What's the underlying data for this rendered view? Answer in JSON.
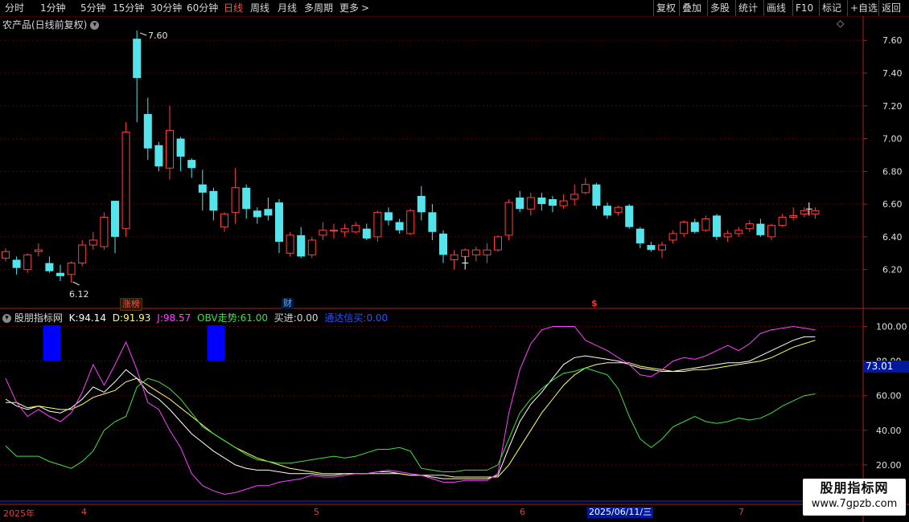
{
  "topbar": {
    "timeframes": [
      "分时",
      "1分钟",
      "5分钟",
      "15分钟",
      "30分钟",
      "60分钟",
      "日线",
      "周线",
      "月线",
      "多周期",
      "更多"
    ],
    "active_timeframe": "日线",
    "more_arrow": ">",
    "right_buttons": [
      "复权",
      "叠加",
      "多股",
      "统计",
      "画线",
      "F10",
      "标记",
      "+自选",
      "返回"
    ]
  },
  "main_pane": {
    "title": "农产品(日线前复权)",
    "dropdown_icon": "circle-chevron-down-icon",
    "diamond_icon": "◇",
    "high_label": "7.60",
    "low_label": "6.12",
    "badges": [
      {
        "text": "涨榜",
        "color": "#ff5050"
      },
      {
        "text": "财",
        "color": "#6fa8ff"
      },
      {
        "text": "$",
        "color": "#ff3030"
      }
    ]
  },
  "indicator_pane": {
    "name": "股朋指标网",
    "k_label": "K:",
    "k_value": "94.14",
    "d_label": "D:",
    "d_value": "91.93",
    "j_label": "J:",
    "j_value": "98.57",
    "obv_label": "OBV走势:",
    "obv_value": "61.00",
    "buy_label": "买进:",
    "buy_value": "0.00",
    "signal_label": "通达信买:",
    "signal_value": "0.00",
    "crosshair_value": "73.01"
  },
  "x_axis": {
    "year_label": "2025年",
    "month_labels": [
      "4",
      "5",
      "6",
      "7"
    ],
    "cursor_date": "2025/06/11/三"
  },
  "watermark": {
    "title": "股朋指标网",
    "url": "www.7gpzb.com"
  },
  "colors": {
    "up": "#ff4040",
    "down": "#54e4ec",
    "k": "#ffffff",
    "d": "#ffff66",
    "j": "#ff40ff",
    "obv": "#40e040",
    "grid": "#5a0000",
    "axis": "#aa2020",
    "signal": "#0000ff"
  },
  "chart_data": [
    {
      "type": "candlestick",
      "title": "农产品(日线前复权)",
      "y_ticks": [
        6.2,
        6.4,
        6.6,
        6.8,
        7.0,
        7.2,
        7.4,
        7.6
      ],
      "ylim": [
        6.12,
        7.66
      ],
      "grid": true,
      "candles": [
        [
          6.27,
          6.31,
          6.25,
          6.33
        ],
        [
          6.26,
          6.21,
          6.17,
          6.28
        ],
        [
          6.2,
          6.29,
          6.18,
          6.3
        ],
        [
          6.31,
          6.32,
          6.28,
          6.36
        ],
        [
          6.24,
          6.19,
          6.18,
          6.28
        ],
        [
          6.18,
          6.16,
          6.13,
          6.23
        ],
        [
          6.17,
          6.24,
          6.12,
          6.25
        ],
        [
          6.24,
          6.35,
          6.22,
          6.38
        ],
        [
          6.35,
          6.38,
          6.32,
          6.43
        ],
        [
          6.34,
          6.52,
          6.32,
          6.55
        ],
        [
          6.62,
          6.4,
          6.3,
          6.62
        ],
        [
          6.45,
          7.04,
          6.4,
          7.1
        ],
        [
          7.61,
          7.37,
          7.1,
          7.66
        ],
        [
          7.15,
          6.94,
          6.87,
          7.25
        ],
        [
          6.96,
          6.83,
          6.8,
          6.98
        ],
        [
          6.82,
          7.05,
          6.75,
          7.2
        ],
        [
          7.0,
          6.89,
          6.8,
          7.01
        ],
        [
          6.87,
          6.82,
          6.76,
          6.88
        ],
        [
          6.72,
          6.67,
          6.56,
          6.81
        ],
        [
          6.68,
          6.56,
          6.5,
          6.7
        ],
        [
          6.46,
          6.54,
          6.43,
          6.55
        ],
        [
          6.55,
          6.7,
          6.48,
          6.82
        ],
        [
          6.7,
          6.57,
          6.51,
          6.72
        ],
        [
          6.56,
          6.52,
          6.48,
          6.58
        ],
        [
          6.57,
          6.53,
          6.5,
          6.64
        ],
        [
          6.61,
          6.37,
          6.3,
          6.63
        ],
        [
          6.3,
          6.41,
          6.28,
          6.43
        ],
        [
          6.41,
          6.28,
          6.27,
          6.46
        ],
        [
          6.29,
          6.38,
          6.27,
          6.4
        ],
        [
          6.41,
          6.44,
          6.38,
          6.49
        ],
        [
          6.44,
          6.44,
          6.39,
          6.48
        ],
        [
          6.43,
          6.45,
          6.4,
          6.48
        ],
        [
          6.43,
          6.47,
          6.42,
          6.49
        ],
        [
          6.45,
          6.39,
          6.38,
          6.48
        ],
        [
          6.4,
          6.55,
          6.37,
          6.56
        ],
        [
          6.55,
          6.5,
          6.47,
          6.58
        ],
        [
          6.49,
          6.44,
          6.42,
          6.51
        ],
        [
          6.42,
          6.56,
          6.41,
          6.57
        ],
        [
          6.65,
          6.55,
          6.5,
          6.71
        ],
        [
          6.55,
          6.43,
          6.38,
          6.6
        ],
        [
          6.42,
          6.29,
          6.24,
          6.44
        ],
        [
          6.26,
          6.29,
          6.2,
          6.32
        ],
        [
          6.28,
          6.32,
          6.27,
          6.33
        ],
        [
          6.29,
          6.32,
          6.25,
          6.34
        ],
        [
          6.29,
          6.32,
          6.24,
          6.36
        ],
        [
          6.32,
          6.4,
          6.31,
          6.41
        ],
        [
          6.41,
          6.61,
          6.38,
          6.63
        ],
        [
          6.64,
          6.57,
          6.55,
          6.68
        ],
        [
          6.57,
          6.64,
          6.53,
          6.67
        ],
        [
          6.64,
          6.6,
          6.56,
          6.67
        ],
        [
          6.63,
          6.59,
          6.55,
          6.65
        ],
        [
          6.59,
          6.62,
          6.57,
          6.66
        ],
        [
          6.63,
          6.66,
          6.59,
          6.72
        ],
        [
          6.67,
          6.72,
          6.66,
          6.76
        ],
        [
          6.72,
          6.59,
          6.57,
          6.73
        ],
        [
          6.59,
          6.53,
          6.51,
          6.61
        ],
        [
          6.55,
          6.58,
          6.53,
          6.59
        ],
        [
          6.59,
          6.46,
          6.45,
          6.6
        ],
        [
          6.45,
          6.36,
          6.33,
          6.46
        ],
        [
          6.35,
          6.32,
          6.31,
          6.37
        ],
        [
          6.32,
          6.35,
          6.27,
          6.37
        ],
        [
          6.38,
          6.42,
          6.36,
          6.44
        ],
        [
          6.42,
          6.49,
          6.4,
          6.5
        ],
        [
          6.49,
          6.43,
          6.42,
          6.51
        ],
        [
          6.44,
          6.51,
          6.43,
          6.53
        ],
        [
          6.53,
          6.4,
          6.38,
          6.54
        ],
        [
          6.4,
          6.42,
          6.37,
          6.44
        ],
        [
          6.42,
          6.44,
          6.4,
          6.46
        ],
        [
          6.45,
          6.48,
          6.43,
          6.5
        ],
        [
          6.48,
          6.41,
          6.4,
          6.51
        ],
        [
          6.4,
          6.47,
          6.38,
          6.48
        ],
        [
          6.47,
          6.52,
          6.46,
          6.54
        ],
        [
          6.52,
          6.53,
          6.5,
          6.58
        ],
        [
          6.54,
          6.56,
          6.52,
          6.58
        ],
        [
          6.54,
          6.56,
          6.51,
          6.58
        ]
      ]
    },
    {
      "type": "line",
      "title": "股朋指标网",
      "y_ticks": [
        20.0,
        40.0,
        60.0,
        80.0,
        100.0
      ],
      "ylim": [
        0,
        103
      ],
      "grid": true,
      "series": [
        {
          "name": "K",
          "color": "#ffffff",
          "values": [
            58,
            54,
            52,
            54,
            51,
            50,
            53,
            58,
            65,
            62,
            68,
            75,
            70,
            62,
            58,
            52,
            45,
            38,
            33,
            28,
            24,
            20,
            18,
            17,
            17,
            16,
            15,
            15,
            15,
            14,
            14,
            15,
            15,
            15,
            16,
            16,
            15,
            14,
            14,
            13,
            12,
            12,
            12,
            12,
            12,
            14,
            30,
            45,
            55,
            62,
            70,
            78,
            82,
            83,
            82,
            81,
            80,
            78,
            76,
            75,
            74,
            74,
            75,
            76,
            77,
            78,
            79,
            79,
            80,
            83,
            86,
            89,
            92,
            94,
            94
          ]
        },
        {
          "name": "D",
          "color": "#ffff66",
          "values": [
            56,
            56,
            53,
            54,
            53,
            52,
            52,
            55,
            59,
            61,
            63,
            68,
            70,
            66,
            62,
            58,
            53,
            48,
            43,
            38,
            34,
            30,
            27,
            24,
            22,
            20,
            18,
            17,
            16,
            15,
            15,
            15,
            15,
            15,
            15,
            15,
            15,
            14,
            14,
            14,
            14,
            13,
            13,
            13,
            13,
            13,
            20,
            30,
            40,
            50,
            58,
            66,
            72,
            76,
            78,
            79,
            79,
            79,
            77,
            76,
            75,
            74,
            74,
            75,
            75,
            76,
            77,
            78,
            79,
            80,
            82,
            85,
            88,
            90,
            92
          ]
        },
        {
          "name": "J",
          "color": "#ff40ff",
          "values": [
            70,
            56,
            48,
            52,
            48,
            45,
            50,
            62,
            78,
            66,
            78,
            91,
            75,
            56,
            52,
            40,
            30,
            15,
            8,
            5,
            3,
            4,
            6,
            8,
            8,
            10,
            11,
            12,
            14,
            13,
            13,
            14,
            15,
            15,
            16,
            17,
            16,
            15,
            14,
            12,
            10,
            10,
            11,
            11,
            11,
            15,
            50,
            75,
            90,
            98,
            100,
            100,
            100,
            92,
            89,
            86,
            82,
            78,
            72,
            71,
            75,
            80,
            82,
            81,
            83,
            86,
            89,
            86,
            90,
            96,
            98,
            99,
            100,
            99,
            98
          ]
        },
        {
          "name": "OBV走势",
          "color": "#40e040",
          "values": [
            31,
            25,
            25,
            25,
            22,
            20,
            18,
            22,
            28,
            40,
            45,
            48,
            65,
            70,
            68,
            64,
            58,
            50,
            42,
            38,
            34,
            30,
            26,
            23,
            22,
            21,
            21,
            22,
            23,
            24,
            25,
            24,
            25,
            27,
            29,
            29,
            30,
            28,
            18,
            17,
            16,
            16,
            17,
            17,
            17,
            20,
            35,
            50,
            58,
            64,
            69,
            73,
            74,
            76,
            74,
            72,
            64,
            48,
            35,
            30,
            35,
            42,
            45,
            48,
            45,
            44,
            45,
            47,
            46,
            47,
            50,
            54,
            57,
            60,
            61
          ]
        },
        {
          "name": "通达信买",
          "color": "#0000ff",
          "type": "bars",
          "values": [
            0,
            0,
            0,
            0,
            100,
            0,
            0,
            0,
            0,
            0,
            0,
            0,
            0,
            0,
            0,
            0,
            0,
            0,
            0,
            100,
            0,
            0,
            0,
            0,
            0,
            0,
            0,
            0,
            0,
            0,
            0,
            0,
            0,
            0,
            0,
            0,
            0,
            0,
            0,
            0,
            0,
            0,
            0,
            0,
            0,
            0,
            0,
            0,
            0,
            0,
            0,
            0,
            0,
            0,
            0,
            0,
            0,
            0,
            0,
            0,
            0,
            0,
            0,
            0,
            0,
            0,
            0,
            0,
            0,
            0,
            0,
            0,
            0,
            0,
            0
          ]
        }
      ]
    }
  ]
}
